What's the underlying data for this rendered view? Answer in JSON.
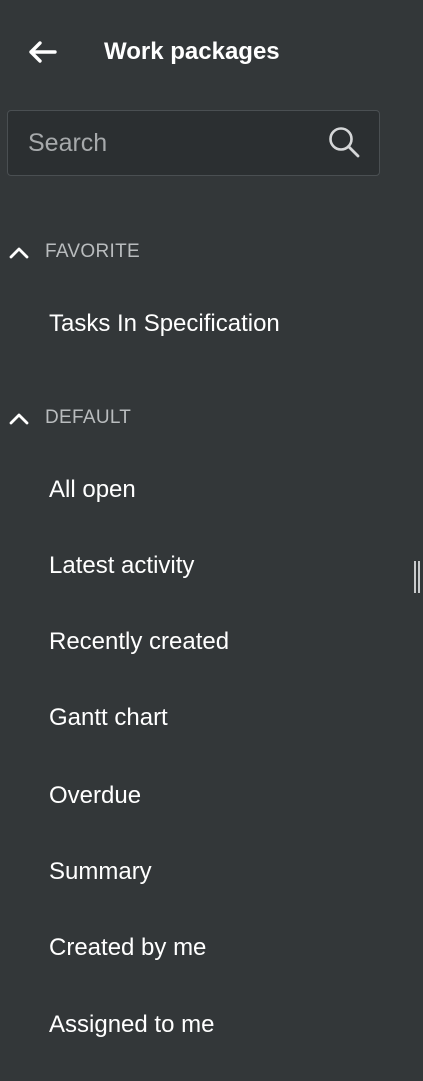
{
  "header": {
    "title": "Work packages",
    "back_icon": "arrow-left-icon"
  },
  "search": {
    "placeholder": "Search",
    "value": "",
    "icon": "search-icon"
  },
  "sections": {
    "favorite": {
      "label": "FAVORITE",
      "expanded": true,
      "items": [
        {
          "label": "Tasks In Specification"
        }
      ]
    },
    "default": {
      "label": "DEFAULT",
      "expanded": true,
      "items": [
        {
          "label": "All open"
        },
        {
          "label": "Latest activity"
        },
        {
          "label": "Recently created"
        },
        {
          "label": "Gantt chart"
        },
        {
          "label": "Overdue"
        },
        {
          "label": "Summary"
        },
        {
          "label": "Created by me"
        },
        {
          "label": "Assigned to me"
        }
      ]
    }
  },
  "colors": {
    "background": "#333739",
    "search_background": "#2b2f31",
    "text": "#ffffff",
    "section_label": "#b9bcbe",
    "placeholder": "#a6a9ab"
  }
}
